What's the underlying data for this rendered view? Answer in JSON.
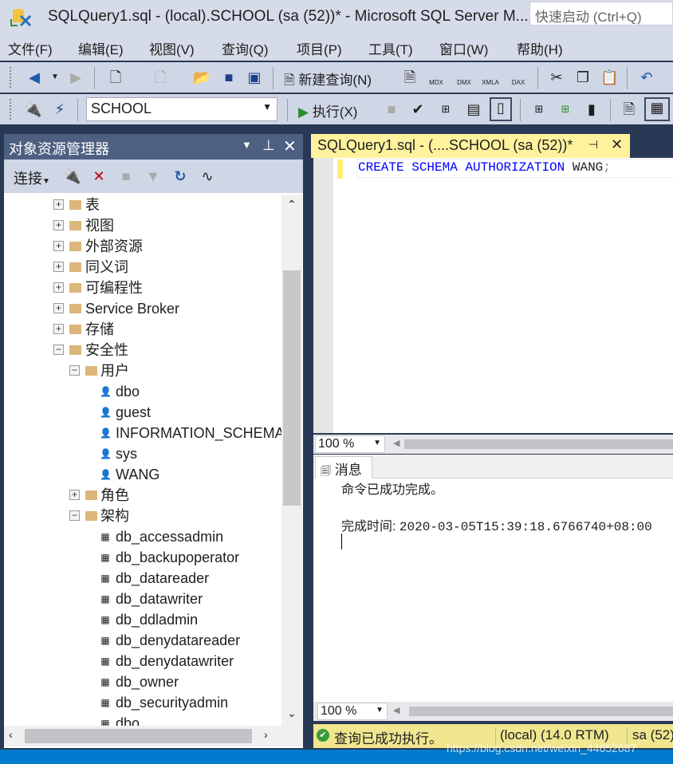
{
  "window": {
    "title": "SQLQuery1.sql - (local).SCHOOL (sa (52))* - Microsoft SQL Server M...",
    "quick_launch_placeholder": "快速启动 (Ctrl+Q)"
  },
  "menu": [
    "文件(F)",
    "编辑(E)",
    "视图(V)",
    "查询(Q)",
    "项目(P)",
    "工具(T)",
    "窗口(W)",
    "帮助(H)"
  ],
  "toolbar1": {
    "new_query": "新建查询(N)",
    "mdx": "MDX",
    "dmx": "DMX",
    "xmla": "XMLA",
    "dax": "DAX"
  },
  "toolbar2": {
    "database": "SCHOOL",
    "execute": "执行(X)"
  },
  "object_explorer": {
    "title": "对象资源管理器",
    "connect": "连接",
    "tree": [
      {
        "label": "表",
        "level": 1,
        "type": "folder",
        "expanded": false
      },
      {
        "label": "视图",
        "level": 1,
        "type": "folder",
        "expanded": false
      },
      {
        "label": "外部资源",
        "level": 1,
        "type": "folder",
        "expanded": false
      },
      {
        "label": "同义词",
        "level": 1,
        "type": "folder",
        "expanded": false
      },
      {
        "label": "可编程性",
        "level": 1,
        "type": "folder",
        "expanded": false
      },
      {
        "label": "Service Broker",
        "level": 1,
        "type": "folder",
        "expanded": false
      },
      {
        "label": "存储",
        "level": 1,
        "type": "folder",
        "expanded": false
      },
      {
        "label": "安全性",
        "level": 1,
        "type": "folder",
        "expanded": true
      },
      {
        "label": "用户",
        "level": 2,
        "type": "folder",
        "expanded": true
      },
      {
        "label": "dbo",
        "level": 3,
        "type": "user"
      },
      {
        "label": "guest",
        "level": 3,
        "type": "user-disabled"
      },
      {
        "label": "INFORMATION_SCHEMA",
        "level": 3,
        "type": "user-disabled"
      },
      {
        "label": "sys",
        "level": 3,
        "type": "user-disabled"
      },
      {
        "label": "WANG",
        "level": 3,
        "type": "user"
      },
      {
        "label": "角色",
        "level": 2,
        "type": "folder",
        "expanded": false
      },
      {
        "label": "架构",
        "level": 2,
        "type": "folder",
        "expanded": true
      },
      {
        "label": "db_accessadmin",
        "level": 3,
        "type": "schema"
      },
      {
        "label": "db_backupoperator",
        "level": 3,
        "type": "schema"
      },
      {
        "label": "db_datareader",
        "level": 3,
        "type": "schema"
      },
      {
        "label": "db_datawriter",
        "level": 3,
        "type": "schema"
      },
      {
        "label": "db_ddladmin",
        "level": 3,
        "type": "schema"
      },
      {
        "label": "db_denydatareader",
        "level": 3,
        "type": "schema"
      },
      {
        "label": "db_denydatawriter",
        "level": 3,
        "type": "schema"
      },
      {
        "label": "db_owner",
        "level": 3,
        "type": "schema"
      },
      {
        "label": "db_securityadmin",
        "level": 3,
        "type": "schema"
      },
      {
        "label": "dbo",
        "level": 3,
        "type": "schema"
      }
    ]
  },
  "query_tab": {
    "title": "SQLQuery1.sql - (....SCHOOL (sa (52))*"
  },
  "editor": {
    "kw1": "CREATE",
    "kw2": "SCHEMA",
    "kw3": "AUTHORIZATION",
    "ident": "WANG",
    "semi": ";"
  },
  "zoom": "100 %",
  "messages": {
    "tab": "消息",
    "line1": "命令已成功完成。",
    "time_label": "完成时间:",
    "time_value": "2020-03-05T15:39:18.6766740+08:00"
  },
  "status": {
    "message": "查询已成功执行。",
    "server": "(local) (14.0 RTM)",
    "user": "sa (52)"
  },
  "watermark": "https://blog.csdn.net/weixin_44652687",
  "colors": {
    "accent_tab": "#fff29d",
    "status_bar": "#efe68f",
    "panel_header": "#4d6082",
    "keyword": "#0000ff"
  }
}
